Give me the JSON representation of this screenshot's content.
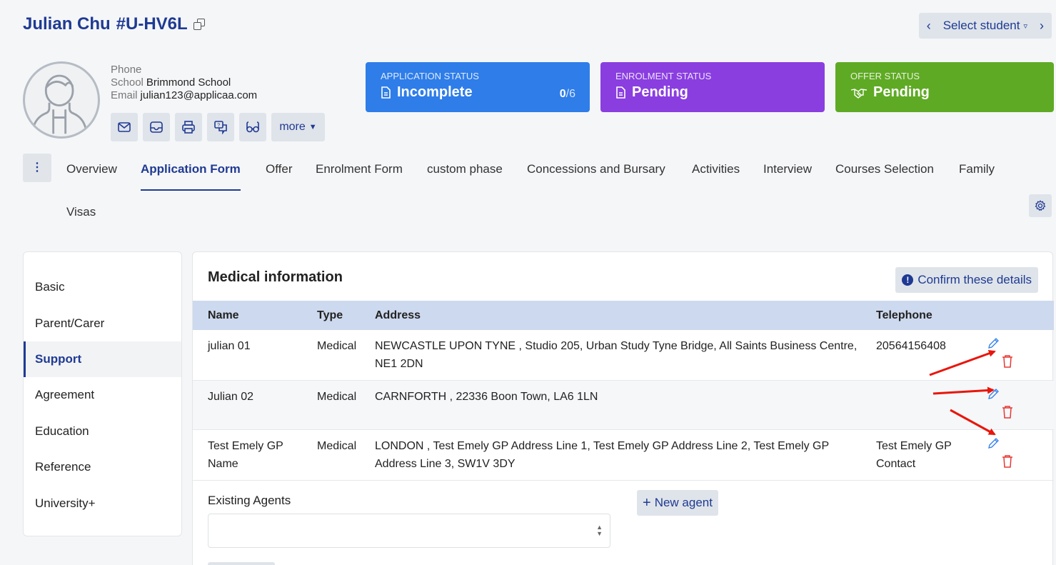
{
  "header": {
    "name": "Julian Chu",
    "id": "#U-HV6L",
    "select_student": "Select student"
  },
  "contact": {
    "phone_label": "Phone",
    "phone_value": "",
    "school_label": "School",
    "school_value": "Brimmond School",
    "email_label": "Email",
    "email_value": "julian123@applicaa.com"
  },
  "quick_actions": {
    "icons": [
      "mail-icon",
      "inbox-icon",
      "print-icon",
      "chat-icon",
      "glasses-icon"
    ],
    "more_label": "more"
  },
  "status_cards": [
    {
      "label": "APPLICATION STATUS",
      "value": "Incomplete",
      "count": "0",
      "total": "/6",
      "color": "#2e7de9",
      "icon": "document-icon"
    },
    {
      "label": "ENROLMENT STATUS",
      "value": "Pending",
      "color": "#8a3ee0",
      "icon": "document-icon"
    },
    {
      "label": "OFFER STATUS",
      "value": "Pending",
      "color": "#5faa24",
      "icon": "handshake-icon"
    }
  ],
  "tabs": [
    "Overview",
    "Application Form",
    "Offer",
    "Enrolment Form",
    "custom phase",
    "Concessions and Bursary",
    "Activities",
    "Interview",
    "Courses Selection",
    "Family",
    "Visas"
  ],
  "active_tab": "Application Form",
  "sidebar": {
    "items": [
      "Basic",
      "Parent/Carer",
      "Support",
      "Agreement",
      "Education",
      "Reference",
      "University+"
    ],
    "active": "Support"
  },
  "panel": {
    "title": "Medical information",
    "confirm_label": "Confirm these details",
    "columns": [
      "Name",
      "Type",
      "Address",
      "Telephone"
    ],
    "rows": [
      {
        "name": "julian 01",
        "type": "Medical",
        "address": "NEWCASTLE UPON TYNE , Studio 205, Urban Study Tyne Bridge, All Saints Business Centre, NE1 2DN",
        "telephone": "20564156408"
      },
      {
        "name": "Julian 02",
        "type": "Medical",
        "address": "CARNFORTH , 22336 Boon Town, LA6 1LN",
        "telephone": ""
      },
      {
        "name": "Test Emely GP Name",
        "type": "Medical",
        "address": "LONDON , Test Emely GP Address Line 1, Test Emely GP Address Line 2, Test Emely GP Address Line 3, SW1V 3DY",
        "telephone": "Test Emely GP Contact"
      }
    ],
    "agents_label": "Existing Agents",
    "new_agent_label": "New agent"
  },
  "colors": {
    "brand": "#1f3a93",
    "annotation_arrow": "#e8160c"
  }
}
